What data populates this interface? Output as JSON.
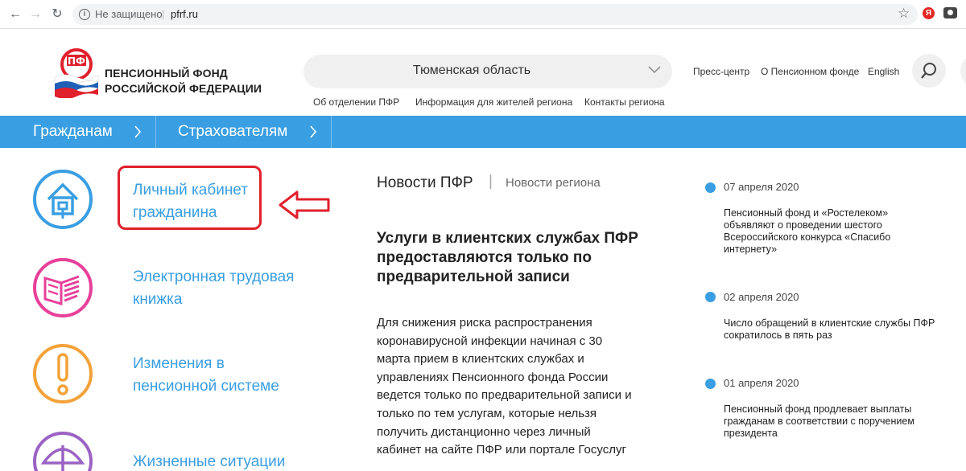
{
  "browser": {
    "security_label": "Не защищено",
    "separator": "|",
    "url": "pfrf.ru",
    "yandex_label": "Я"
  },
  "header": {
    "logo_line1": "ПЕНСИОННЫЙ ФОНД",
    "logo_line2": "РОССИЙСКОЙ ФЕДЕРАЦИИ",
    "region": "Тюменская область",
    "top_links": [
      "Пресс-центр",
      "О Пенсионном фонде",
      "English"
    ],
    "sub_links": [
      "Об отделении  ПФР",
      "Информация для жителей региона",
      "Контакты региона"
    ]
  },
  "nav": {
    "tabs": [
      "Гражданам",
      "Страхователям"
    ]
  },
  "services": [
    {
      "line1": "Личный кабинет",
      "line2": "гражданина",
      "icon": "house-icon",
      "color": "#3a9ee2"
    },
    {
      "line1": "Электронная трудовая",
      "line2": "книжка",
      "icon": "book-icon",
      "color": "#e8409a"
    },
    {
      "line1": "Изменения в",
      "line2": "пенсионной системе",
      "icon": "exclamation-icon",
      "color": "#f3a23a"
    },
    {
      "line1": "Жизненные ситуации",
      "line2": "",
      "icon": "umbrella-icon",
      "color": "#9b62c4"
    }
  ],
  "news": {
    "tab_main": "Новости ПФР",
    "tab_sep": "|",
    "tab_region": "Новости региона",
    "headline": "Услуги в клиентских службах ПФР предоставляются только по предварительной записи",
    "body_lines": [
      "Для снижения риска распространения",
      "коронавирусной инфекции начиная с 30",
      "марта прием в клиентских службах и",
      "управлениях Пенсионного фонда России",
      "ведется только по предварительной записи и",
      "только по тем услугам, которые нельзя",
      "получить дистанционно через личный",
      "кабинет на сайте ПФР или портале Госуслуг"
    ]
  },
  "side_news": [
    {
      "date": "07 апреля 2020",
      "lines": [
        "Пенсионный фонд и «Ростелеком»",
        "объявляют о проведении шестого",
        "Всероссийского конкурса «Спасибо",
        "интернету»"
      ]
    },
    {
      "date": "02 апреля 2020",
      "lines": [
        "Число обращений в клиентские службы ПФР",
        "сократилось в пять раз"
      ]
    },
    {
      "date": "01 апреля 2020",
      "lines": [
        "Пенсионный фонд продлевает выплаты",
        "гражданам в соответствии с поручением",
        "президента"
      ]
    }
  ],
  "colors": {
    "accent_blue": "#3a9ee2",
    "annotation_red": "#e0202c"
  }
}
